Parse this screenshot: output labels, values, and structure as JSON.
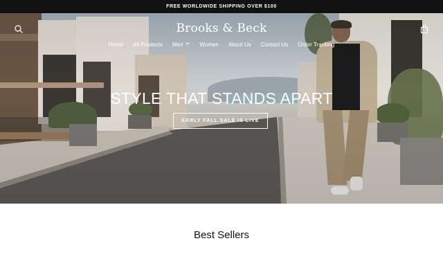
{
  "announcement": {
    "text": "FREE WORLDWIDE SHIPPING OVER $100"
  },
  "header": {
    "logo": "Brooks & Beck",
    "icons": {
      "search": "search-icon",
      "cart": "cart-icon"
    }
  },
  "nav": {
    "items": [
      {
        "label": "Home"
      },
      {
        "label": "All Products"
      },
      {
        "label": "Men",
        "has_dropdown": true
      },
      {
        "label": "Women"
      },
      {
        "label": "About Us"
      },
      {
        "label": "Contact Us"
      },
      {
        "label": "Order Tracking"
      }
    ]
  },
  "hero": {
    "headline": "STYLE THAT STANDS APART",
    "button_label": "EARLY FALL SALE IS LIVE"
  },
  "sections": {
    "best_sellers_title": "Best Sellers"
  },
  "colors": {
    "announcement_bg": "#111111",
    "text_on_hero": "#ffffff",
    "page_bg": "#ffffff"
  }
}
